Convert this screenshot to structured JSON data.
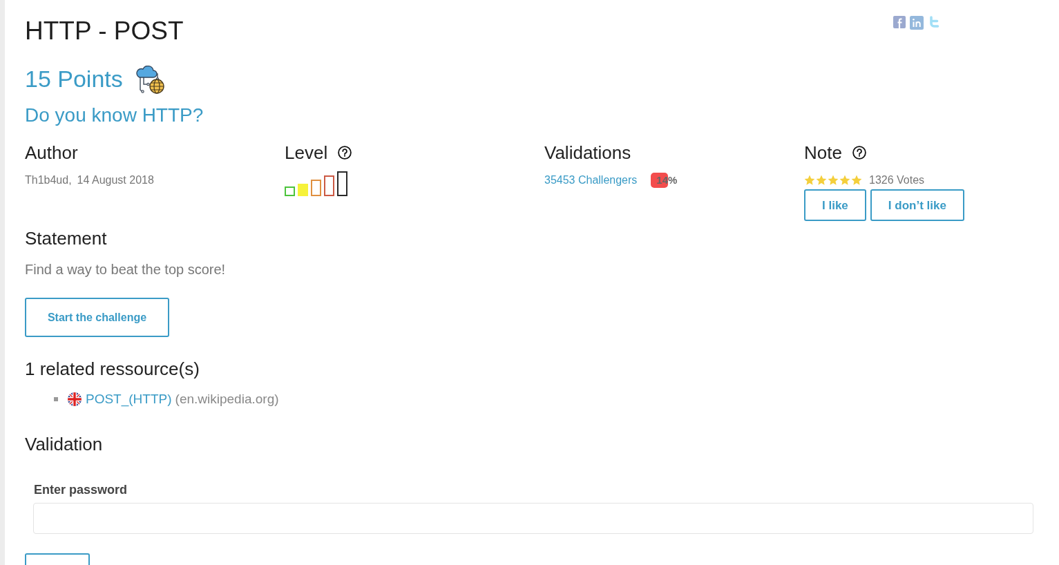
{
  "title": "HTTP - POST",
  "points": "15 Points",
  "subtitle": "Do you know HTTP?",
  "info": {
    "author": {
      "heading": "Author",
      "name": "Th1b4ud,",
      "date": "14 August 2018"
    },
    "level": {
      "heading": "Level",
      "bars": [
        {
          "color": "#4cc43c",
          "selected": false
        },
        {
          "color": "#f6f23a",
          "selected": true
        },
        {
          "color": "#e09040",
          "selected": false
        },
        {
          "color": "#cc5a44",
          "selected": false
        },
        {
          "color": "#2a2a2a",
          "selected": false
        }
      ]
    },
    "validations": {
      "heading": "Validations",
      "challengers": "35453 Challengers",
      "rate": "14%"
    },
    "note": {
      "heading": "Note",
      "stars": 5,
      "votes": "1326 Votes",
      "buttons": [
        "I like",
        "I don’t like"
      ]
    }
  },
  "statement": {
    "heading": "Statement",
    "text": "Find a way to beat the top score!",
    "button": "Start the challenge"
  },
  "resources": {
    "heading": "1 related ressource(s)",
    "items": [
      {
        "link": "POST_(HTTP)",
        "source": "(en.wikipedia.org)"
      }
    ]
  },
  "validation": {
    "heading": "Validation",
    "label": "Enter password"
  }
}
